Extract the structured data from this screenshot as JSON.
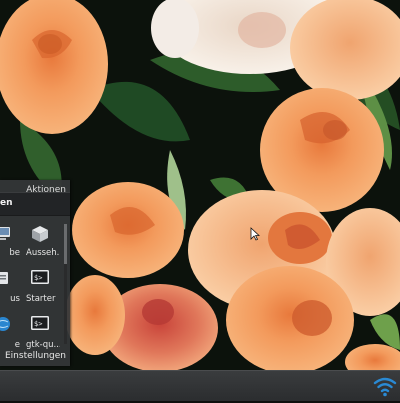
{
  "menu": {
    "actions_label": "Aktionen",
    "heading": "en",
    "items": [
      {
        "label": "be",
        "icon": "appearance-icon"
      },
      {
        "label": "Ausseh...",
        "icon": "cube-icon"
      },
      {
        "label": "us",
        "icon": "preferences-icon"
      },
      {
        "label": "Starter",
        "icon": "terminal-icon"
      },
      {
        "label": "e",
        "icon": "globe-icon"
      },
      {
        "label": "gtk-qu...",
        "icon": "terminal-icon"
      }
    ],
    "settings_label": "Einstellungen"
  },
  "tray": {
    "icon": "wifi-icon"
  },
  "colors": {
    "panel_bg": "#343638",
    "taskbar_bg": "#2e3032",
    "wifi_accent": "#2a8ad4"
  }
}
